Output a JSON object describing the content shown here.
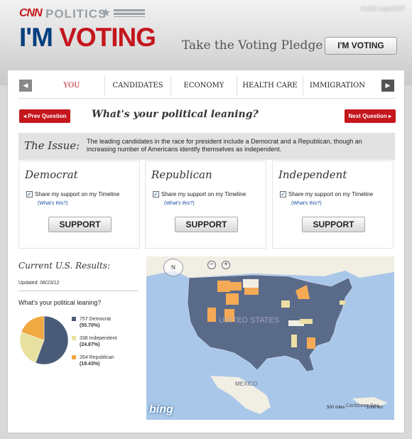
{
  "header": {
    "habla": "Habla español?",
    "logo_cnn": "CNN",
    "logo_politics": "POLITICS",
    "logo_im": "I'M ",
    "logo_voting": "VOTING",
    "pledge": "Take the Voting Pledge",
    "im_voting_button": "I'M VOTING"
  },
  "nav": {
    "tabs": [
      "YOU",
      "CANDIDATES",
      "ECONOMY",
      "HEALTH CARE",
      "IMMIGRATION"
    ],
    "selected": "YOU"
  },
  "question": {
    "prev": "◂ Prev Question",
    "next": "Next Question ▸",
    "title": "What's your political leaning?"
  },
  "issue": {
    "label": "The Issue:",
    "text": "The leading candidates in the race for president include a Democrat and a Republican, though an increasing number of Americans identify themselves as independent."
  },
  "parties": [
    {
      "name": "Democrat",
      "share": "Share my support on my Timeline",
      "whats": "(What's this?)",
      "button": "SUPPORT"
    },
    {
      "name": "Republican",
      "share": "Share my support on my Timeline",
      "whats": "(What's this?)",
      "button": "SUPPORT"
    },
    {
      "name": "Independent",
      "share": "Share my support on my Timeline",
      "whats": "(What's this?)",
      "button": "SUPPORT"
    }
  ],
  "results": {
    "title": "Current U.S. Results:",
    "updated": "Updated: 08/23/12",
    "question": "What's your political leaning?",
    "legend": [
      {
        "label": "757 Democrat",
        "pct": "(55.70%)",
        "value": 55.7,
        "color": "#4a5b78"
      },
      {
        "label": "338 Independent",
        "pct": "(24.87%)",
        "value": 24.87,
        "color": "#e8e0a0"
      },
      {
        "label": "264 Republican",
        "pct": "(19.43%)",
        "value": 19.43,
        "color": "#f0a840"
      }
    ]
  },
  "map": {
    "nav_letter": "N",
    "zoom_out": "−",
    "zoom_in": "+",
    "label_us": "UNITED STATES",
    "label_mexico": "MEXICO",
    "label_caribbean": "Caribbean Sea",
    "bing": "bing",
    "scale_miles": "500 miles",
    "scale_km": "1000 km",
    "colors": {
      "democrat": "#5a6b8a",
      "republican": "#f5aa55",
      "independent": "#ecdfa3",
      "land": "#f1eee4",
      "water": "#a9c7e8"
    }
  }
}
